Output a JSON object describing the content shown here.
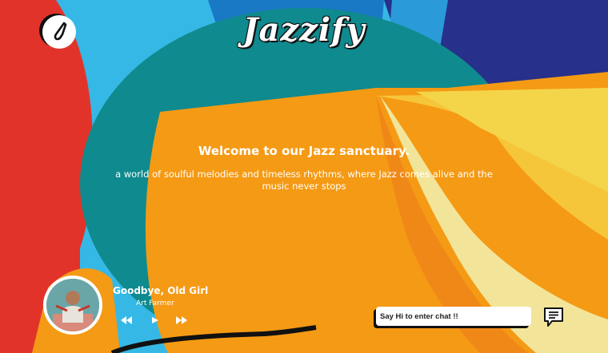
{
  "header": {
    "brand": "Jazzify",
    "logo_icon": "saxophone-icon"
  },
  "hero": {
    "welcome": "Welcome to our Jazz sanctuary.",
    "tagline": "a world of soulful melodies and timeless rhythms, where Jazz comes alive and the music never stops"
  },
  "player": {
    "title": "Goodbye, Old Girl",
    "artist": "Art Farmer",
    "controls": [
      "rewind-icon",
      "play-icon",
      "fast-forward-icon"
    ]
  },
  "chat": {
    "placeholder": "Say Hi to enter chat !!",
    "button_icon": "chat-icon"
  },
  "colors": {
    "orange": "#f59a14",
    "teal": "#0f8a8e",
    "sky": "#35b8e6",
    "red": "#e2332a",
    "navy": "#21318c",
    "yellow": "#f4d54a",
    "cream": "#f2e59a"
  }
}
